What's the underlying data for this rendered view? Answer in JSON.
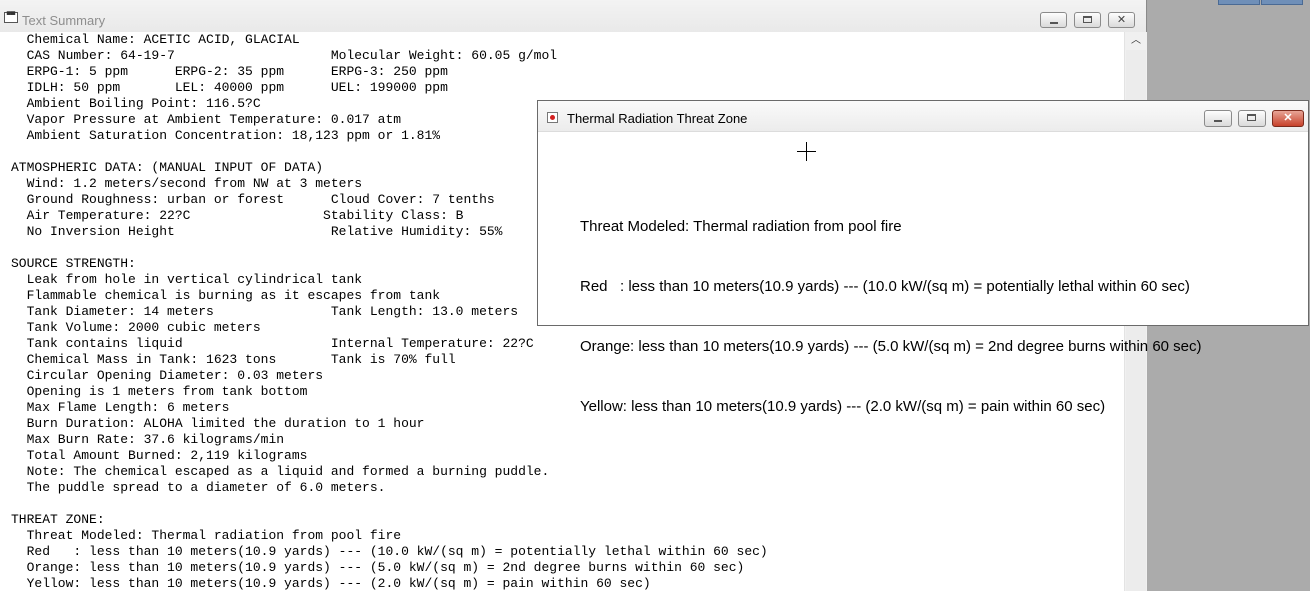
{
  "main_window": {
    "title": "Text Summary",
    "icon": "text-summary-app-icon",
    "buttons": {
      "minimize": "minimize-icon",
      "maximize": "maximize-icon",
      "close": "close-icon"
    },
    "scrollbar": {
      "up_arrow": "^"
    },
    "lines": [
      "  Chemical Name: ACETIC ACID, GLACIAL",
      "  CAS Number: 64-19-7                    Molecular Weight: 60.05 g/mol",
      "  ERPG-1: 5 ppm      ERPG-2: 35 ppm      ERPG-3: 250 ppm",
      "  IDLH: 50 ppm       LEL: 40000 ppm      UEL: 199000 ppm",
      "  Ambient Boiling Point: 116.5?C",
      "  Vapor Pressure at Ambient Temperature: 0.017 atm",
      "  Ambient Saturation Concentration: 18,123 ppm or 1.81%",
      "",
      "ATMOSPHERIC DATA: (MANUAL INPUT OF DATA)",
      "  Wind: 1.2 meters/second from NW at 3 meters",
      "  Ground Roughness: urban or forest      Cloud Cover: 7 tenths",
      "  Air Temperature: 22?C                 Stability Class: B",
      "  No Inversion Height                    Relative Humidity: 55%",
      "",
      "SOURCE STRENGTH:",
      "  Leak from hole in vertical cylindrical tank",
      "  Flammable chemical is burning as it escapes from tank",
      "  Tank Diameter: 14 meters               Tank Length: 13.0 meters",
      "  Tank Volume: 2000 cubic meters",
      "  Tank contains liquid                   Internal Temperature: 22?C",
      "  Chemical Mass in Tank: 1623 tons       Tank is 70% full",
      "  Circular Opening Diameter: 0.03 meters",
      "  Opening is 1 meters from tank bottom",
      "  Max Flame Length: 6 meters",
      "  Burn Duration: ALOHA limited the duration to 1 hour",
      "  Max Burn Rate: 37.6 kilograms/min",
      "  Total Amount Burned: 2,119 kilograms",
      "  Note: The chemical escaped as a liquid and formed a burning puddle.",
      "  The puddle spread to a diameter of 6.0 meters.",
      "",
      "THREAT ZONE:",
      "  Threat Modeled: Thermal radiation from pool fire",
      "  Red   : less than 10 meters(10.9 yards) --- (10.0 kW/(sq m) = potentially lethal within 60 sec)",
      "  Orange: less than 10 meters(10.9 yards) --- (5.0 kW/(sq m) = 2nd degree burns within 60 sec)",
      "  Yellow: less than 10 meters(10.9 yards) --- (2.0 kW/(sq m) = pain within 60 sec)"
    ]
  },
  "threat_window": {
    "title": "Thermal Radiation Threat Zone",
    "icon": "threat-zone-icon",
    "buttons": {
      "minimize": "minimize-icon",
      "maximize": "maximize-icon",
      "close": "close-icon"
    },
    "cursor": "crosshair-cursor-icon",
    "threat_modeled": "Threat Modeled: Thermal radiation from pool fire",
    "zones": [
      {
        "label": "Red   : less than 10 meters(10.9 yards) --- (10.0 kW/(sq m) = potentially lethal within 60 sec)",
        "color": "#ff0000"
      },
      {
        "label": "Orange: less than 10 meters(10.9 yards) --- (5.0 kW/(sq m) = 2nd degree burns within 60 sec)",
        "color": "#ff9900"
      },
      {
        "label": "Yellow: less than 10 meters(10.9 yards) --- (2.0 kW/(sq m) = pain within 60 sec)",
        "color": "#ffff00"
      }
    ]
  },
  "colors": {
    "close_button": "#c7412a",
    "desktop_background": "#aaaaaa"
  }
}
